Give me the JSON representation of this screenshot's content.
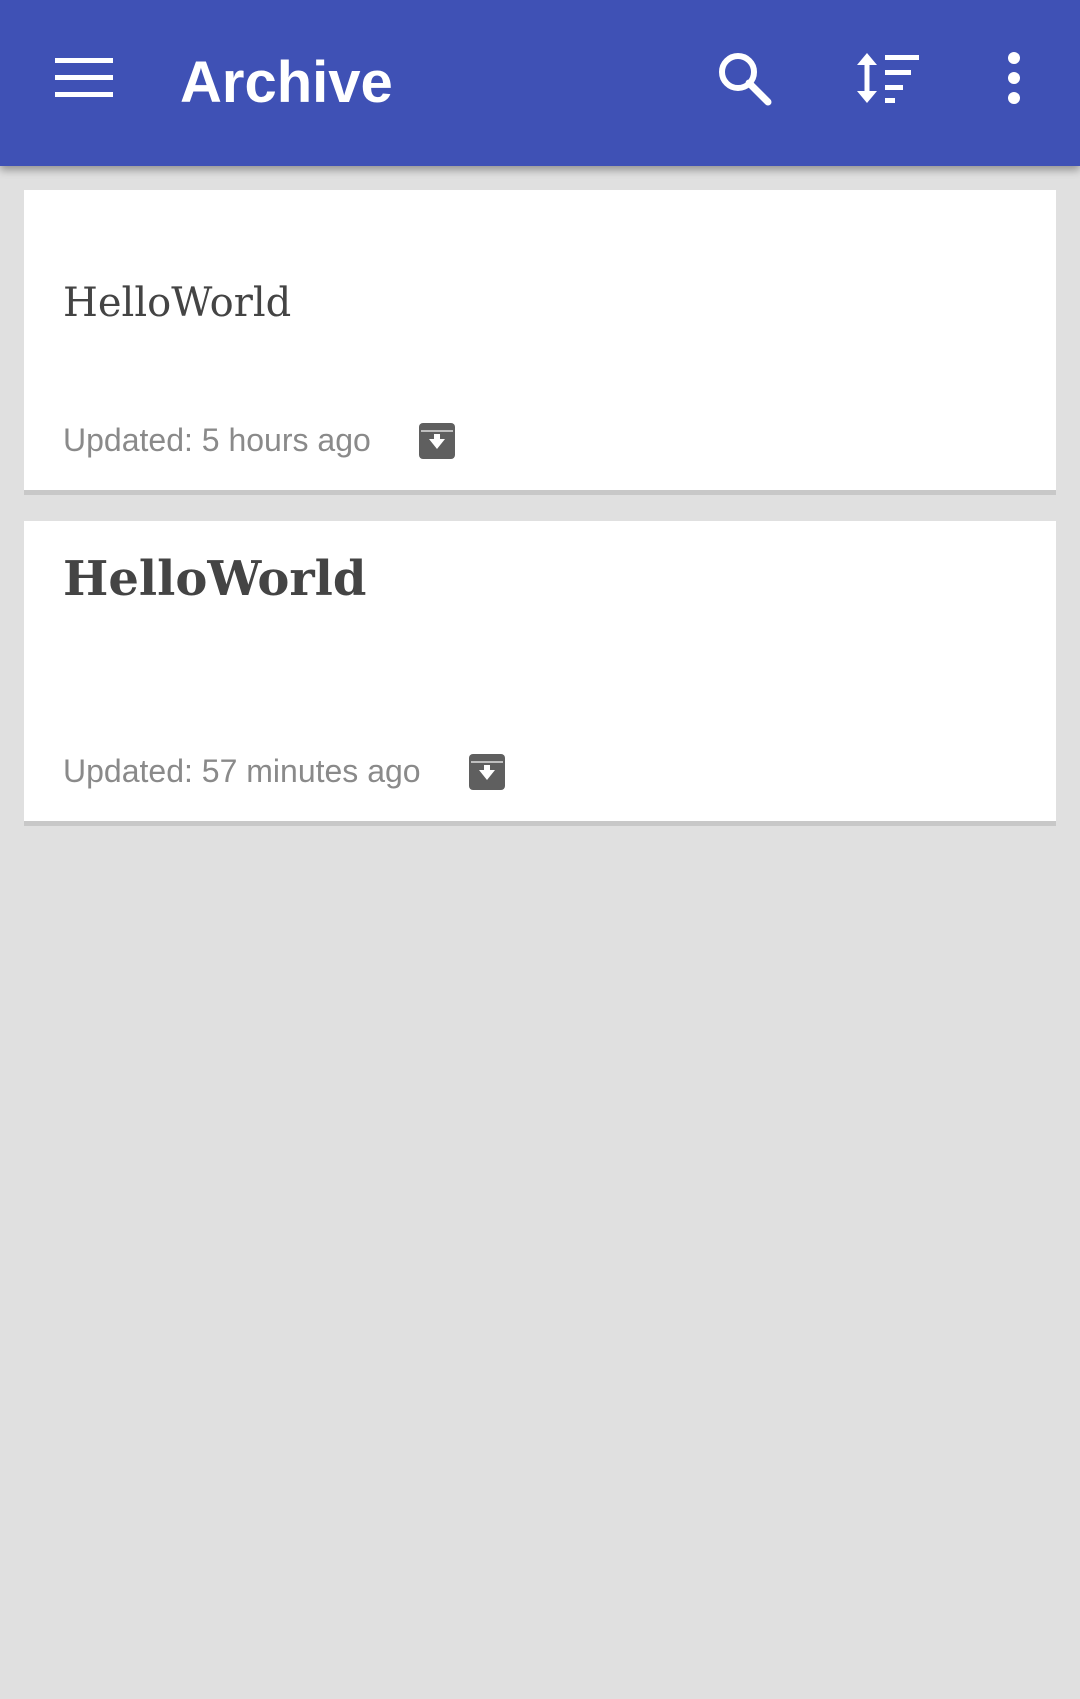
{
  "appbar": {
    "title": "Archive",
    "background_color": "#3f51b5",
    "nav_icon": "menu-icon",
    "actions": [
      {
        "icon": "search-icon"
      },
      {
        "icon": "sort-icon"
      },
      {
        "icon": "more-vert-icon"
      }
    ]
  },
  "notes": [
    {
      "title": "HelloWorld",
      "title_style": "plain",
      "updated": "Updated: 5 hours ago",
      "status_icon": "archive-icon"
    },
    {
      "title": "HelloWorld",
      "title_style": "bold",
      "updated": "Updated: 57 minutes ago",
      "status_icon": "archive-icon"
    }
  ]
}
